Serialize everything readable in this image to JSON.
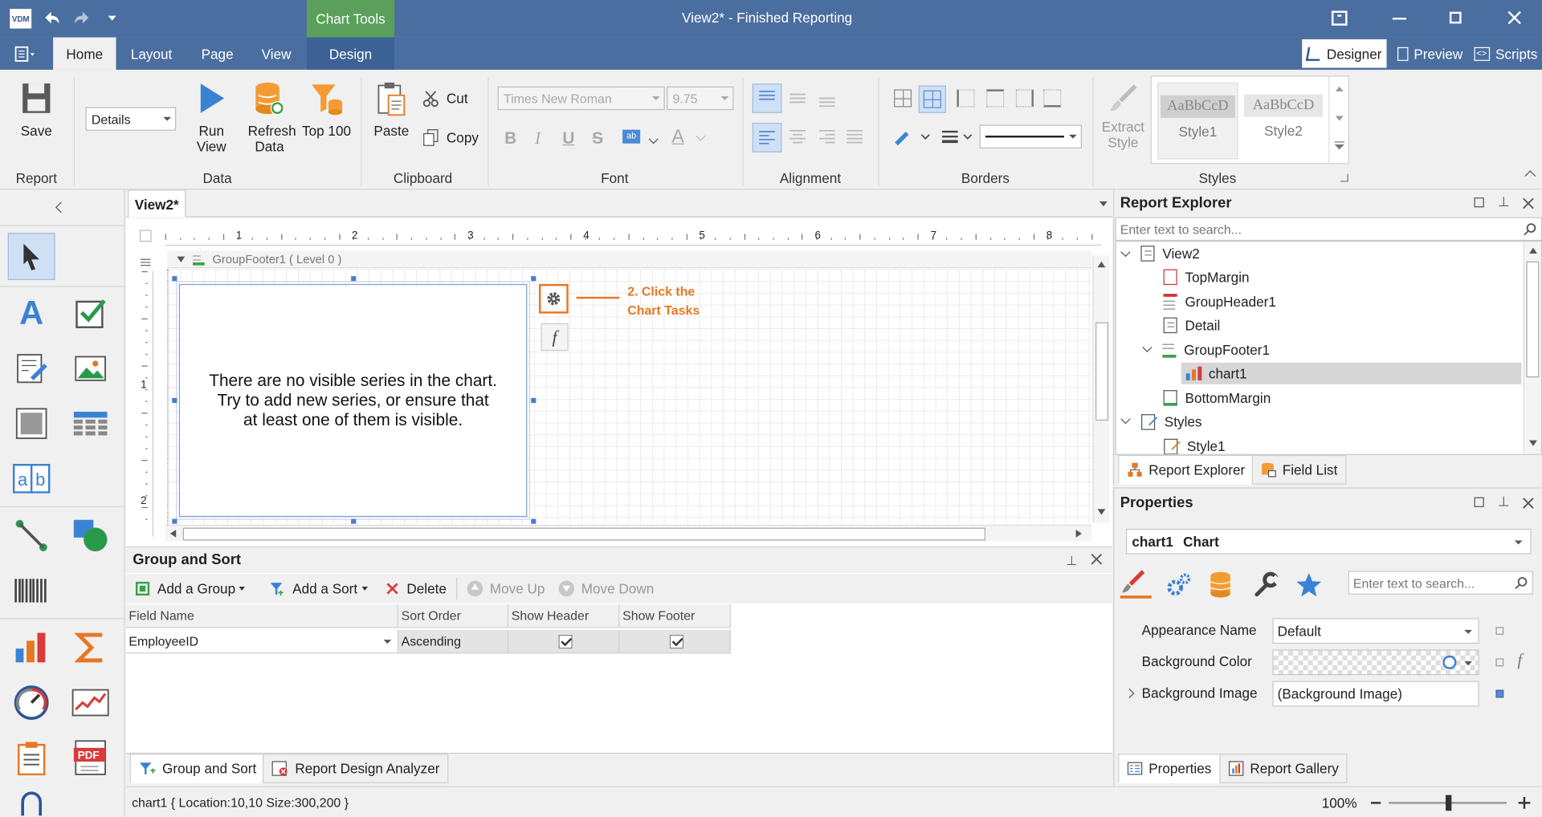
{
  "window": {
    "title": "View2* - Finished Reporting",
    "contextual_tab": "Chart Tools",
    "app_badge": "VDM"
  },
  "tabs": [
    "Home",
    "Layout",
    "Page",
    "View",
    "Design"
  ],
  "modes": {
    "designer": "Designer",
    "preview": "Preview",
    "scripts": "Scripts"
  },
  "ribbon": {
    "report": {
      "title": "Report",
      "save": "Save"
    },
    "data": {
      "title": "Data",
      "combo": "Details",
      "run_view": "Run View",
      "refresh_data": "Refresh Data",
      "top100": "Top 100"
    },
    "clipboard": {
      "title": "Clipboard",
      "paste": "Paste",
      "cut": "Cut",
      "copy": "Copy"
    },
    "font": {
      "title": "Font",
      "font_name": "Times New Roman",
      "font_size": "9.75",
      "bold": "B",
      "italic": "I",
      "underline": "U",
      "strike": "S",
      "ab": "ab",
      "a": "A"
    },
    "alignment": {
      "title": "Alignment"
    },
    "borders": {
      "title": "Borders"
    },
    "styles": {
      "title": "Styles",
      "extract_line1": "Extract",
      "extract_line2": "Style",
      "sample": "AaBbCcD",
      "style1": "Style1",
      "style2": "Style2"
    }
  },
  "doc_tab": "View2*",
  "ruler_numbers": [
    "1",
    "2",
    "3",
    "4",
    "5",
    "6",
    "7",
    "8"
  ],
  "ruler_left_numbers": [
    "1",
    "2"
  ],
  "band_label": "GroupFooter1 ( Level 0 )",
  "chart_message": [
    "There are no visible series in the chart.",
    "Try to add new series, or ensure that",
    "at least one of them is visible."
  ],
  "annotation": [
    "2. Click the",
    "Chart Tasks"
  ],
  "smart_tag_f": "f",
  "group_sort": {
    "title": "Group and Sort",
    "add_group": "Add a Group",
    "add_sort": "Add a Sort",
    "delete": "Delete",
    "move_up": "Move Up",
    "move_down": "Move Down",
    "columns": [
      "Field Name",
      "Sort Order",
      "Show Header",
      "Show Footer"
    ],
    "row": {
      "field": "EmployeeID",
      "order": "Ascending"
    }
  },
  "bottom_tabs": {
    "group_sort": "Group and Sort",
    "analyzer": "Report Design Analyzer"
  },
  "status": {
    "text": "chart1 { Location:10,10 Size:300,200 }",
    "zoom": "100%"
  },
  "explorer": {
    "title": "Report Explorer",
    "search_placeholder": "Enter text to search...",
    "items": [
      "View2",
      "TopMargin",
      "GroupHeader1",
      "Detail",
      "GroupFooter1",
      "chart1",
      "BottomMargin",
      "Styles",
      "Style1"
    ],
    "tabs": [
      "Report Explorer",
      "Field List"
    ]
  },
  "properties": {
    "title": "Properties",
    "selector": "chart1",
    "selector_type": "Chart",
    "search_placeholder": "Enter text to search...",
    "rows": [
      {
        "label": "Appearance Name",
        "value": "Default"
      },
      {
        "label": "Background Color",
        "value": ""
      },
      {
        "label": "Background Image",
        "value": "(Background Image)"
      }
    ],
    "f_mark": "f",
    "tabs": [
      "Properties",
      "Report Gallery"
    ]
  },
  "colors": {
    "title_bar": "#4b6ea0",
    "accent_orange": "#e87722",
    "selection": "#d6d6d6"
  }
}
